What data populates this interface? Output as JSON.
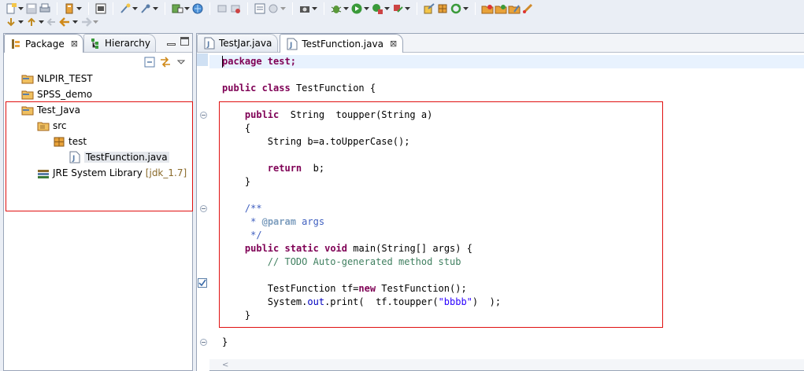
{
  "toolbar": {
    "row1": [
      "new-icon",
      "save-icon",
      "print-icon",
      "new-server-icon",
      "open-console-icon",
      "new-java-project-icon",
      "new-java-package-icon",
      "new-class-icon",
      "web-browser-icon",
      "back-history-icon",
      "forward-history-icon",
      "build-icon",
      "settings-icon",
      "camera-icon",
      "debug-icon",
      "run-icon",
      "coverage-icon",
      "external-tools-icon",
      "open-type-icon",
      "open-package-icon",
      "refresh-icon",
      "open-folder-icon",
      "open-folder2-icon",
      "edit-icon",
      "rocket-icon"
    ],
    "row2": [
      "next-annotation-icon",
      "previous-annotation-icon",
      "last-edit-icon",
      "back-icon",
      "forward-icon"
    ]
  },
  "left_view": {
    "tabs": [
      {
        "label": "Package",
        "active": true,
        "icon": "package-explorer-icon",
        "close": "⊠"
      },
      {
        "label": "Hierarchy",
        "active": false,
        "icon": "hierarchy-icon"
      }
    ],
    "tree": [
      {
        "label": "NLPIR_TEST",
        "icon": "project-icon",
        "depth": 0
      },
      {
        "label": "SPSS_demo",
        "icon": "project-icon",
        "depth": 0
      },
      {
        "label": "Test_Java",
        "icon": "project-icon",
        "depth": 0
      },
      {
        "label": "src",
        "icon": "source-folder-icon",
        "depth": 1
      },
      {
        "label": "test",
        "icon": "package-icon",
        "depth": 2
      },
      {
        "label": "TestFunction.java",
        "icon": "java-file-icon",
        "depth": 3,
        "selected": true
      },
      {
        "label": "JRE System Library",
        "decoration": "[jdk_1.7]",
        "icon": "library-icon",
        "depth": 1
      }
    ]
  },
  "editor": {
    "tabs": [
      {
        "label": "TestJar.java",
        "active": false,
        "icon": "java-file-icon"
      },
      {
        "label": "TestFunction.java",
        "active": true,
        "icon": "java-file-icon",
        "close": "⊠"
      }
    ],
    "code": {
      "l1": "package test;",
      "l2_kw1": "public",
      "l2_kw2": "class",
      "l2_rest": " TestFunction {",
      "l3_kw": "public",
      "l3_rest": "  String  toupper(String a)",
      "l4": "{",
      "l5": "String b=a.toUpperCase();",
      "l6_kw": "return",
      "l6_rest": "  b;",
      "l7": "}",
      "l8": "/**",
      "l9_star": " * ",
      "l9_tag": "@param",
      "l9_rest": " args",
      "l10": " */",
      "l11_kw1": "public",
      "l11_kw2": "static",
      "l11_kw3": "void",
      "l11_rest": " main(String[] args) {",
      "l12": "// TODO Auto-generated method stub",
      "l13_a": "TestFunction tf=",
      "l13_kw": "new",
      "l13_b": " TestFunction();",
      "l14_a": "System.",
      "l14_field": "out",
      "l14_b": ".print(  tf.toupper(",
      "l14_str": "\"bbbb\"",
      "l14_c": ")  );",
      "l15": "}",
      "l16": "}"
    },
    "scroll_arrow": "<"
  }
}
